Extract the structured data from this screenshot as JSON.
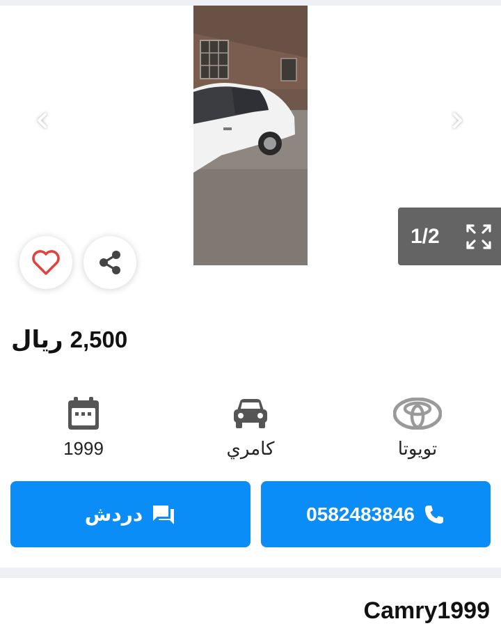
{
  "gallery": {
    "counter": "1/2",
    "prev_icon": "chevron-left-icon",
    "next_icon": "chevron-right-icon",
    "expand_icon": "fullscreen-icon"
  },
  "actions": {
    "favorite_icon": "heart-icon",
    "share_icon": "share-icon"
  },
  "listing": {
    "price_value": "2,500",
    "price_currency": "ريال",
    "title": "Camry1999"
  },
  "specs": {
    "year": "1999",
    "model": "كامري",
    "brand": "تويوتا"
  },
  "buttons": {
    "chat_label": "دردش",
    "phone_label": "0582483846"
  },
  "colors": {
    "accent": "#0b8df8",
    "favorite": "#e0443d",
    "counter_bg": "#646464",
    "separator": "#eef0f5"
  }
}
